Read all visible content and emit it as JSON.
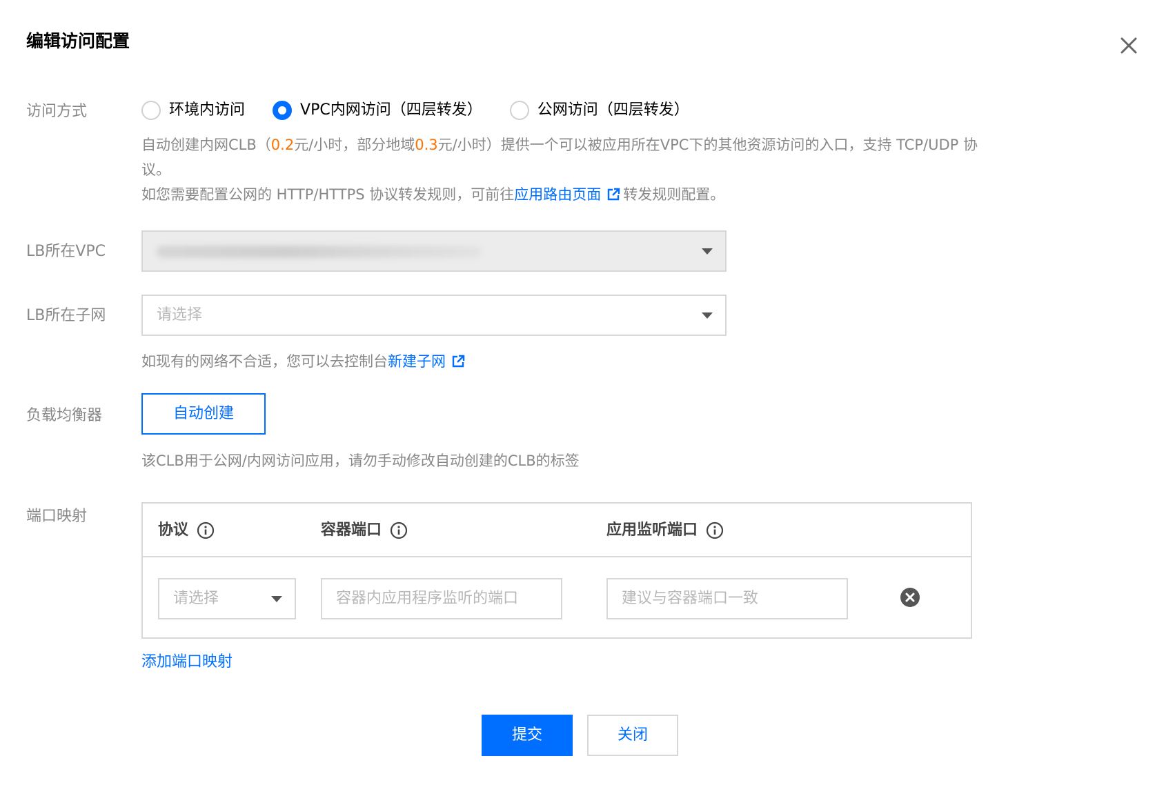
{
  "dialog": {
    "title": "编辑访问配置"
  },
  "access_mode": {
    "label": "访问方式",
    "options": [
      "环境内访问",
      "VPC内网访问（四层转发）",
      "公网访问（四层转发）"
    ],
    "selected_index": 1,
    "desc": {
      "line1_prefix": "自动创建内网CLB（",
      "price1": "0.2",
      "line1_mid": "元/小时，部分地域",
      "price2": "0.3",
      "line1_suffix": "元/小时）提供一个可以被应用所在VPC下的其他资源访问的入口，支持 TCP/UDP 协",
      "line2": "议。",
      "line3_prefix": "如您需要配置公网的 HTTP/HTTPS 协议转发规则，可前往",
      "line3_link": "应用路由页面",
      "line3_suffix": "转发规则配置。"
    }
  },
  "lb_vpc": {
    "label": "LB所在VPC"
  },
  "lb_subnet": {
    "label": "LB所在子网",
    "placeholder": "请选择",
    "hint_prefix": "如现有的网络不合适，您可以去控制台",
    "hint_link": "新建子网"
  },
  "load_balancer": {
    "label": "负载均衡器",
    "button": "自动创建",
    "hint": "该CLB用于公网/内网访问应用，请勿手动修改自动创建的CLB的标签"
  },
  "port_mapping": {
    "label": "端口映射",
    "columns": [
      "协议",
      "容器端口",
      "应用监听端口"
    ],
    "row": {
      "protocol_placeholder": "请选择",
      "container_port_placeholder": "容器内应用程序监听的端口",
      "listen_port_placeholder": "建议与容器端口一致"
    },
    "add_link": "添加端口映射"
  },
  "footer": {
    "submit": "提交",
    "close": "关闭"
  },
  "colors": {
    "primary": "#006eff",
    "orange": "#ff7200",
    "muted": "#888888",
    "border": "#d8d8d8"
  }
}
